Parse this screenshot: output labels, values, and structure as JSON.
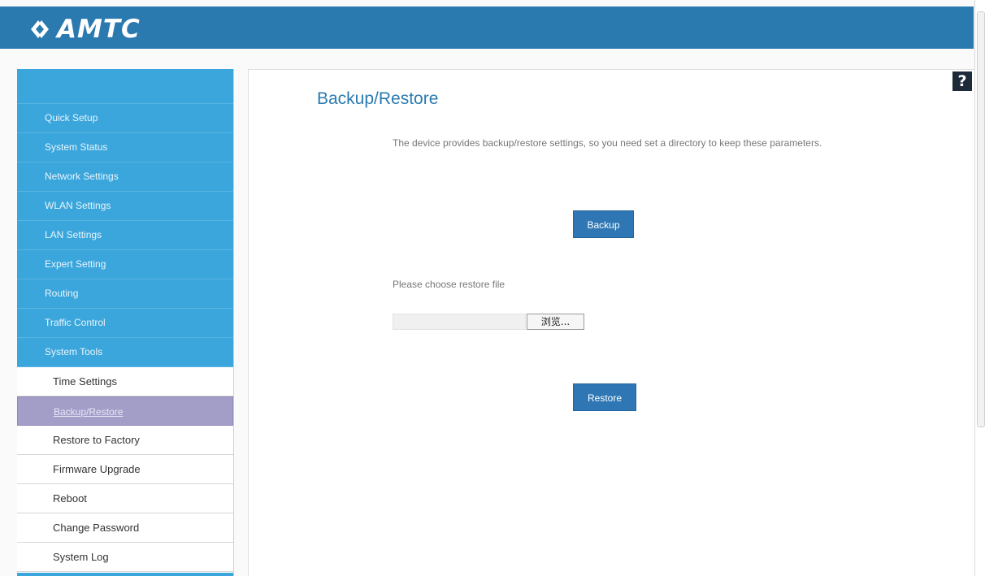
{
  "header": {
    "logo_text": "AMTC",
    "logo_icon": "amtc-logo-icon",
    "bg_color": "#2a7ab0"
  },
  "sidebar": {
    "menu": [
      {
        "label": "Quick Setup"
      },
      {
        "label": "System Status"
      },
      {
        "label": "Network Settings"
      },
      {
        "label": "WLAN Settings"
      },
      {
        "label": "LAN Settings"
      },
      {
        "label": "Expert Setting"
      },
      {
        "label": "Routing"
      },
      {
        "label": "Traffic Control"
      },
      {
        "label": "System Tools"
      }
    ],
    "submenu": [
      {
        "label": "Time Settings",
        "active": false
      },
      {
        "label": "Backup/Restore",
        "active": true
      },
      {
        "label": "Restore to Factory",
        "active": false
      },
      {
        "label": "Firmware Upgrade",
        "active": false
      },
      {
        "label": "Reboot",
        "active": false
      },
      {
        "label": "Change Password",
        "active": false
      },
      {
        "label": "System Log",
        "active": false
      }
    ],
    "menu_color": "#3ba6dc",
    "active_color": "#a39ec8"
  },
  "main": {
    "help_icon": "help-icon",
    "help_label": "?",
    "title": "Backup/Restore",
    "description": "The device provides backup/restore settings, so you need set a directory to keep these parameters.",
    "backup_button": "Backup",
    "restore_label": "Please choose restore file",
    "file_input_value": "",
    "browse_button": "浏览...",
    "restore_button": "Restore"
  }
}
